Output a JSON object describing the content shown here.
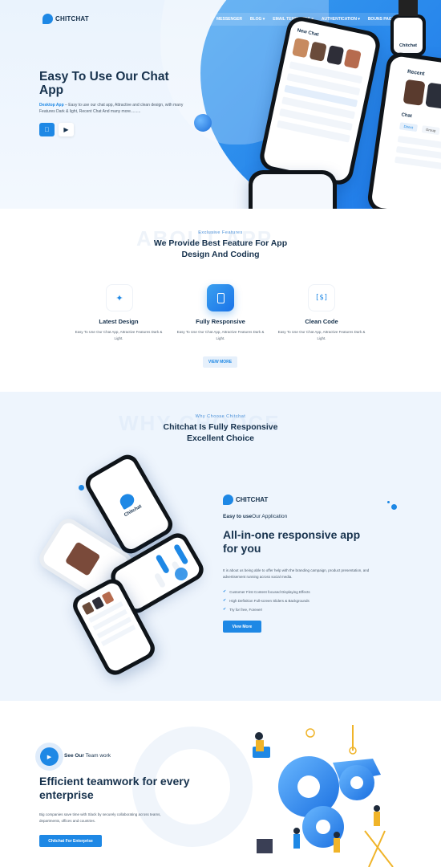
{
  "brand": {
    "name": "CHITCHAT"
  },
  "nav": {
    "items": [
      "MESSENGER",
      "BLOG ▾",
      "EMAIL TEMPLATES ▾",
      "AUTHENTICATION ▾",
      "BOUNS PAGE ▾"
    ]
  },
  "hero": {
    "title": "Easy To Use Our Chat App",
    "desc_highlight": "Desktop App",
    "desc_rest": " – Easy to use our chat app, Attractive and clean design, with many Features Dark & light, Recent Chat And many more.........",
    "watch_label": "Chitchat",
    "phone_left_title": "New Chat",
    "phone_right_title": "Recent",
    "phone_right_sub": "Chat",
    "phone_right_btns": [
      "Direct",
      "Group"
    ]
  },
  "features": {
    "kicker": "Exclusive Features",
    "ghost": "ABOUT APP",
    "title": "We Provide Best Feature For App Design And Coding",
    "items": [
      {
        "icon": "wand-icon",
        "title": "Latest Design",
        "desc": "Easy To Use Our Chat App, Attractive Features Dark & Light."
      },
      {
        "icon": "mobile-icon",
        "title": "Fully Responsive",
        "desc": "Easy To Use Our Chat App, Attractive Features Dark & Light."
      },
      {
        "icon": "code-icon",
        "title": "Clean Code",
        "desc": "Easy To Use Our Chat App, Attractive Features Dark & Light."
      }
    ],
    "view_more": "VIEW MORE"
  },
  "why": {
    "kicker": "Why Choose Chitchat",
    "ghost": "WHY CHOOCE",
    "title": "Chitchat Is Fully Responsive Excellent Choice",
    "brand": "CHITCHAT",
    "sub_bold": "Easy to use",
    "sub_rest": "Our Application",
    "heading": "All-in-one responsive app for you",
    "desc": "It is about us being able to offer help with the branding campaign, product presentation, and advertisement running across social media.",
    "checks": [
      "Customer First Content focused Displaying Effects",
      "High Definition Full-screen Sliders & Backgrounds",
      "Try for free, Forever!"
    ],
    "button": "View More",
    "phone_brand": "Chitchat"
  },
  "team": {
    "play_bold": "See Our",
    "play_rest": " Team work",
    "heading": "Efficient teamwork for every enterprise",
    "desc": "Big companies save time with Slack by securely collaborating across teams, departments, offices and countries.",
    "button": "Chitchat For Enterprise"
  },
  "colors": {
    "accent": "#1e88e5",
    "dark": "#17324d",
    "light_bg": "#eef5fd"
  }
}
